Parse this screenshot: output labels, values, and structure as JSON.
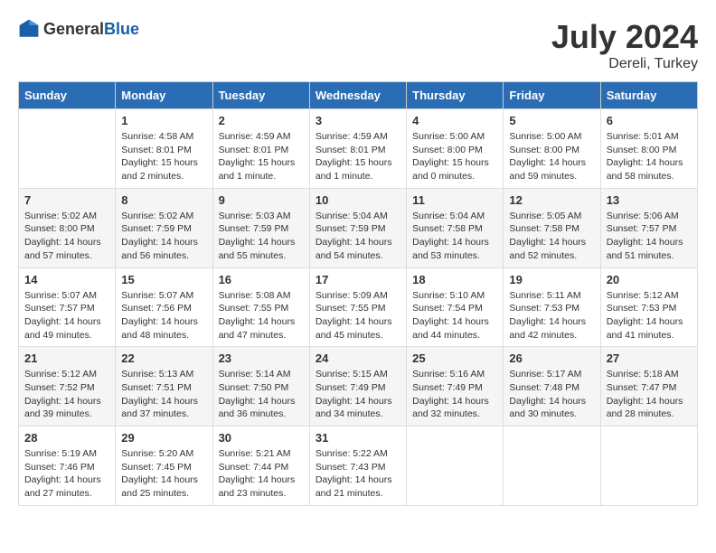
{
  "header": {
    "logo_general": "General",
    "logo_blue": "Blue",
    "month_year": "July 2024",
    "location": "Dereli, Turkey"
  },
  "days_of_week": [
    "Sunday",
    "Monday",
    "Tuesday",
    "Wednesday",
    "Thursday",
    "Friday",
    "Saturday"
  ],
  "weeks": [
    [
      {
        "day": "",
        "sunrise": "",
        "sunset": "",
        "daylight": ""
      },
      {
        "day": "1",
        "sunrise": "Sunrise: 4:58 AM",
        "sunset": "Sunset: 8:01 PM",
        "daylight": "Daylight: 15 hours and 2 minutes."
      },
      {
        "day": "2",
        "sunrise": "Sunrise: 4:59 AM",
        "sunset": "Sunset: 8:01 PM",
        "daylight": "Daylight: 15 hours and 1 minute."
      },
      {
        "day": "3",
        "sunrise": "Sunrise: 4:59 AM",
        "sunset": "Sunset: 8:01 PM",
        "daylight": "Daylight: 15 hours and 1 minute."
      },
      {
        "day": "4",
        "sunrise": "Sunrise: 5:00 AM",
        "sunset": "Sunset: 8:00 PM",
        "daylight": "Daylight: 15 hours and 0 minutes."
      },
      {
        "day": "5",
        "sunrise": "Sunrise: 5:00 AM",
        "sunset": "Sunset: 8:00 PM",
        "daylight": "Daylight: 14 hours and 59 minutes."
      },
      {
        "day": "6",
        "sunrise": "Sunrise: 5:01 AM",
        "sunset": "Sunset: 8:00 PM",
        "daylight": "Daylight: 14 hours and 58 minutes."
      }
    ],
    [
      {
        "day": "7",
        "sunrise": "Sunrise: 5:02 AM",
        "sunset": "Sunset: 8:00 PM",
        "daylight": "Daylight: 14 hours and 57 minutes."
      },
      {
        "day": "8",
        "sunrise": "Sunrise: 5:02 AM",
        "sunset": "Sunset: 7:59 PM",
        "daylight": "Daylight: 14 hours and 56 minutes."
      },
      {
        "day": "9",
        "sunrise": "Sunrise: 5:03 AM",
        "sunset": "Sunset: 7:59 PM",
        "daylight": "Daylight: 14 hours and 55 minutes."
      },
      {
        "day": "10",
        "sunrise": "Sunrise: 5:04 AM",
        "sunset": "Sunset: 7:59 PM",
        "daylight": "Daylight: 14 hours and 54 minutes."
      },
      {
        "day": "11",
        "sunrise": "Sunrise: 5:04 AM",
        "sunset": "Sunset: 7:58 PM",
        "daylight": "Daylight: 14 hours and 53 minutes."
      },
      {
        "day": "12",
        "sunrise": "Sunrise: 5:05 AM",
        "sunset": "Sunset: 7:58 PM",
        "daylight": "Daylight: 14 hours and 52 minutes."
      },
      {
        "day": "13",
        "sunrise": "Sunrise: 5:06 AM",
        "sunset": "Sunset: 7:57 PM",
        "daylight": "Daylight: 14 hours and 51 minutes."
      }
    ],
    [
      {
        "day": "14",
        "sunrise": "Sunrise: 5:07 AM",
        "sunset": "Sunset: 7:57 PM",
        "daylight": "Daylight: 14 hours and 49 minutes."
      },
      {
        "day": "15",
        "sunrise": "Sunrise: 5:07 AM",
        "sunset": "Sunset: 7:56 PM",
        "daylight": "Daylight: 14 hours and 48 minutes."
      },
      {
        "day": "16",
        "sunrise": "Sunrise: 5:08 AM",
        "sunset": "Sunset: 7:55 PM",
        "daylight": "Daylight: 14 hours and 47 minutes."
      },
      {
        "day": "17",
        "sunrise": "Sunrise: 5:09 AM",
        "sunset": "Sunset: 7:55 PM",
        "daylight": "Daylight: 14 hours and 45 minutes."
      },
      {
        "day": "18",
        "sunrise": "Sunrise: 5:10 AM",
        "sunset": "Sunset: 7:54 PM",
        "daylight": "Daylight: 14 hours and 44 minutes."
      },
      {
        "day": "19",
        "sunrise": "Sunrise: 5:11 AM",
        "sunset": "Sunset: 7:53 PM",
        "daylight": "Daylight: 14 hours and 42 minutes."
      },
      {
        "day": "20",
        "sunrise": "Sunrise: 5:12 AM",
        "sunset": "Sunset: 7:53 PM",
        "daylight": "Daylight: 14 hours and 41 minutes."
      }
    ],
    [
      {
        "day": "21",
        "sunrise": "Sunrise: 5:12 AM",
        "sunset": "Sunset: 7:52 PM",
        "daylight": "Daylight: 14 hours and 39 minutes."
      },
      {
        "day": "22",
        "sunrise": "Sunrise: 5:13 AM",
        "sunset": "Sunset: 7:51 PM",
        "daylight": "Daylight: 14 hours and 37 minutes."
      },
      {
        "day": "23",
        "sunrise": "Sunrise: 5:14 AM",
        "sunset": "Sunset: 7:50 PM",
        "daylight": "Daylight: 14 hours and 36 minutes."
      },
      {
        "day": "24",
        "sunrise": "Sunrise: 5:15 AM",
        "sunset": "Sunset: 7:49 PM",
        "daylight": "Daylight: 14 hours and 34 minutes."
      },
      {
        "day": "25",
        "sunrise": "Sunrise: 5:16 AM",
        "sunset": "Sunset: 7:49 PM",
        "daylight": "Daylight: 14 hours and 32 minutes."
      },
      {
        "day": "26",
        "sunrise": "Sunrise: 5:17 AM",
        "sunset": "Sunset: 7:48 PM",
        "daylight": "Daylight: 14 hours and 30 minutes."
      },
      {
        "day": "27",
        "sunrise": "Sunrise: 5:18 AM",
        "sunset": "Sunset: 7:47 PM",
        "daylight": "Daylight: 14 hours and 28 minutes."
      }
    ],
    [
      {
        "day": "28",
        "sunrise": "Sunrise: 5:19 AM",
        "sunset": "Sunset: 7:46 PM",
        "daylight": "Daylight: 14 hours and 27 minutes."
      },
      {
        "day": "29",
        "sunrise": "Sunrise: 5:20 AM",
        "sunset": "Sunset: 7:45 PM",
        "daylight": "Daylight: 14 hours and 25 minutes."
      },
      {
        "day": "30",
        "sunrise": "Sunrise: 5:21 AM",
        "sunset": "Sunset: 7:44 PM",
        "daylight": "Daylight: 14 hours and 23 minutes."
      },
      {
        "day": "31",
        "sunrise": "Sunrise: 5:22 AM",
        "sunset": "Sunset: 7:43 PM",
        "daylight": "Daylight: 14 hours and 21 minutes."
      },
      {
        "day": "",
        "sunrise": "",
        "sunset": "",
        "daylight": ""
      },
      {
        "day": "",
        "sunrise": "",
        "sunset": "",
        "daylight": ""
      },
      {
        "day": "",
        "sunrise": "",
        "sunset": "",
        "daylight": ""
      }
    ]
  ]
}
